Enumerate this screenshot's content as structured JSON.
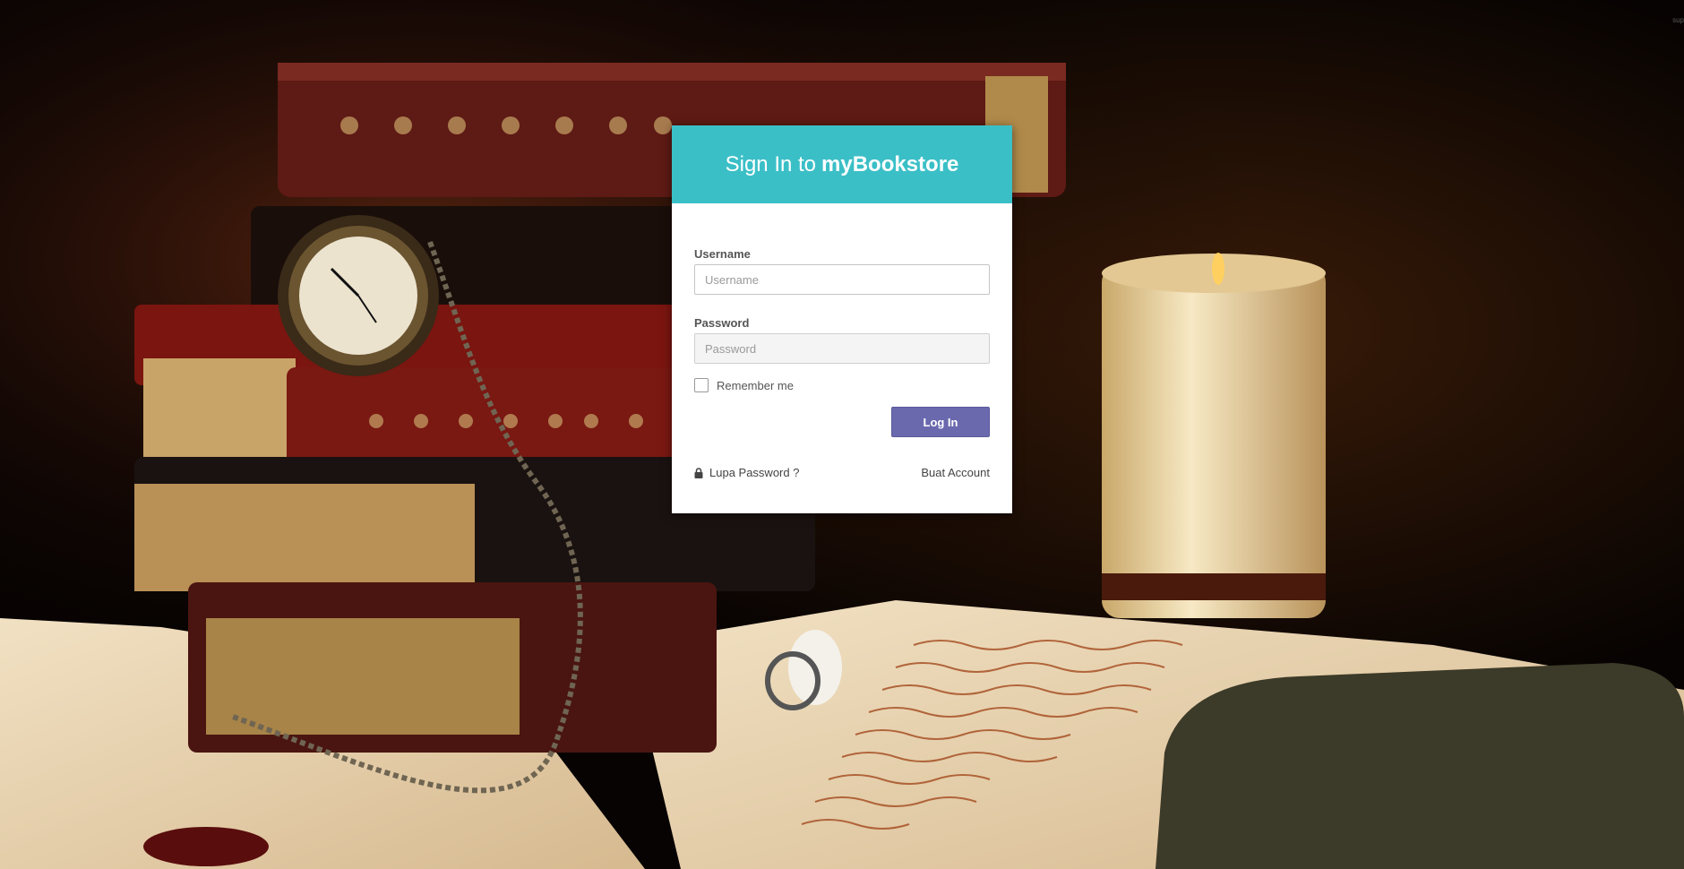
{
  "header": {
    "title_prefix": "Sign In to",
    "brand_name": "myBookstore",
    "color": "#3bbfc7"
  },
  "corner_text": "sup",
  "form": {
    "username_label": "Username",
    "username_placeholder": "Username",
    "username_value": "",
    "password_label": "Password",
    "password_placeholder": "Password",
    "password_value": "",
    "remember_label": "Remember me",
    "remember_checked": false,
    "login_label": "Log In",
    "login_color": "#6a69ae"
  },
  "links": {
    "forgot_password": "Lupa Password ?",
    "forgot_icon": "lock-icon",
    "create_account": "Buat Account"
  }
}
